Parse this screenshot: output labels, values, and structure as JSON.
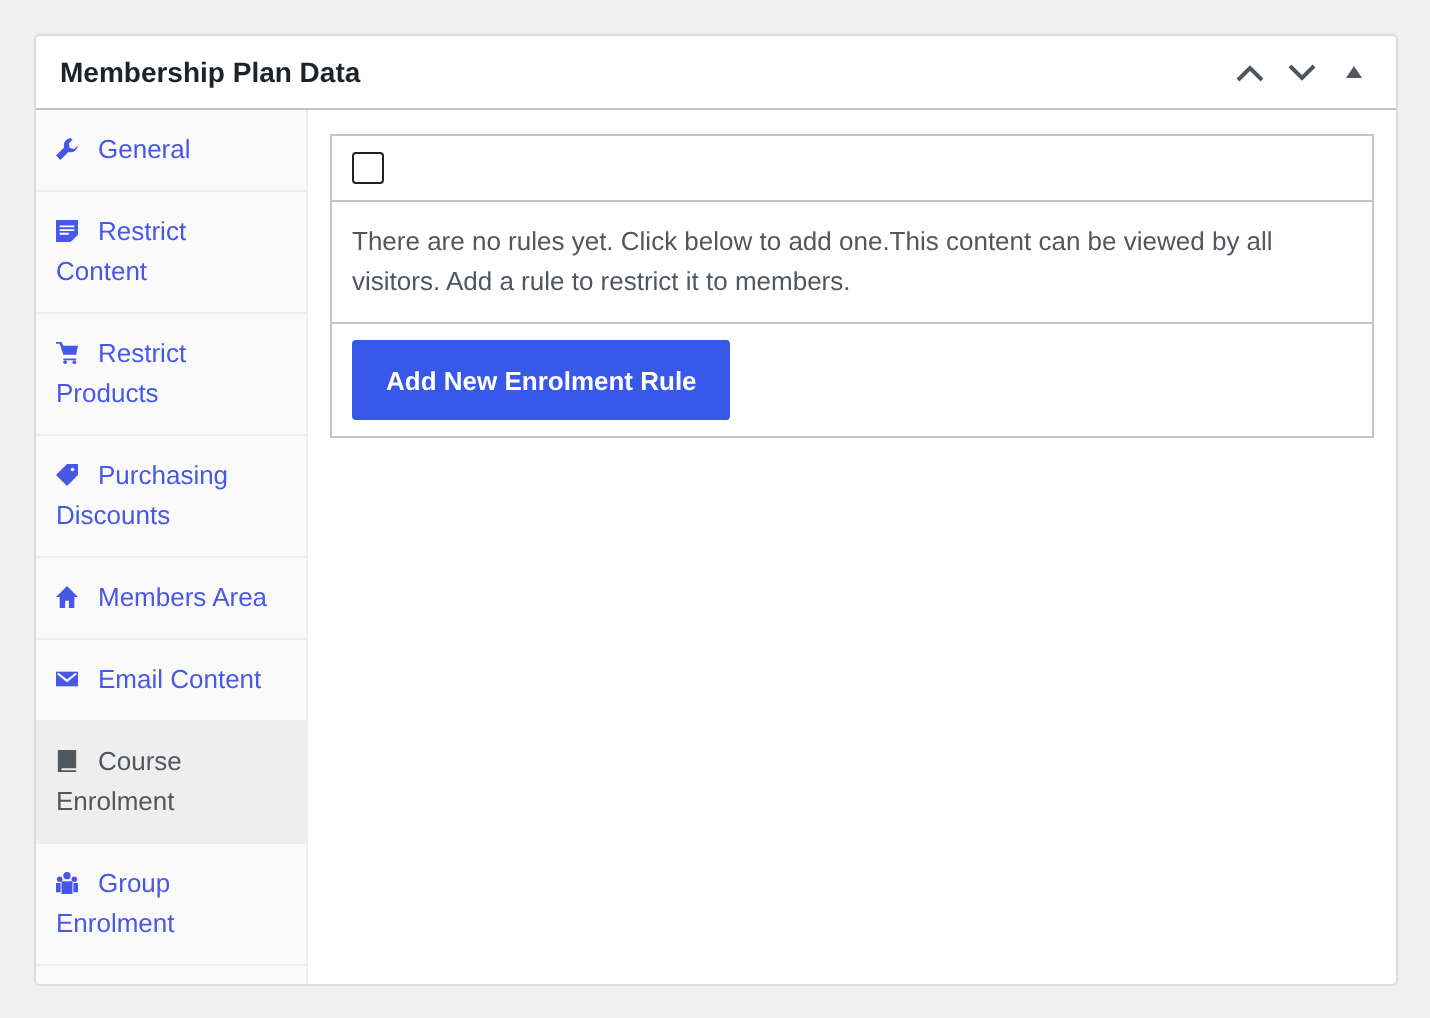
{
  "panel": {
    "title": "Membership Plan Data"
  },
  "tabs": [
    {
      "label": "General",
      "kind": "wrench",
      "selected": false
    },
    {
      "label": "Restrict Content",
      "kind": "document",
      "selected": false
    },
    {
      "label": "Restrict Products",
      "kind": "cart",
      "selected": false
    },
    {
      "label": "Purchasing Discounts",
      "kind": "tag",
      "selected": false
    },
    {
      "label": "Members Area",
      "kind": "house",
      "selected": false
    },
    {
      "label": "Email Content",
      "kind": "envelope",
      "selected": false
    },
    {
      "label": "Course Enrolment",
      "kind": "book",
      "selected": true
    },
    {
      "label": "Group Enrolment",
      "kind": "group",
      "selected": false
    }
  ],
  "rules": {
    "select_all_checked": false,
    "message": "There are no rules yet. Click below to add one.This content can be viewed by all visitors. Add a rule to restrict it to members.",
    "add_button": "Add New Enrolment Rule"
  }
}
